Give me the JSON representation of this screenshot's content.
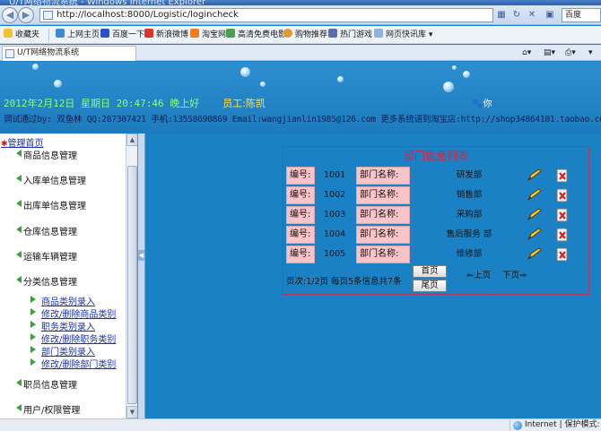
{
  "browser": {
    "window_title": "U/T网络物流系统 - Windows Internet Explorer",
    "url": "http://localhost:8000/Logistic/logincheck",
    "search_placeholder": "百度",
    "favorites_label": "收藏夹",
    "favorites": [
      "上网主页",
      "百度一下",
      "新浪微博",
      "淘宝网",
      "高清免费电影",
      "购物推荐",
      "热门游戏",
      "网页快讯库 ▾"
    ],
    "tab_title": "U/T网络物流系统",
    "status_zone": "Internet | 保护模式: 禁用"
  },
  "header": {
    "datetime": "2012年2月12日 星期日 20:47:46 晚上好",
    "staff": "员工:陈凯",
    "contact": "调试通过by: 双鱼林 QQ:287307421 手机:13558690869 Email:wangjianlin1985@126.com 更多系统请到淘宝店:http://shop34864101.taobao.com",
    "mascot_text": "你"
  },
  "menu": {
    "home": "管理首页",
    "categories": [
      "商品信息管理",
      "入库单信息管理",
      "出库单信息管理",
      "仓库信息管理",
      "运输车辆管理",
      "分类信息管理",
      "职员信息管理",
      "用户/权限管理"
    ],
    "subitems": [
      "商品类别录入",
      "修改/删除商品类别",
      "职务类别录入",
      "修改/删除职务类别",
      "部门类别录入",
      "修改/删除部门类别"
    ]
  },
  "main": {
    "title": "部门信息列表",
    "id_label": "编号:",
    "name_label": "部门名称:",
    "rows": [
      {
        "id": "1001",
        "name": "研发部"
      },
      {
        "id": "1002",
        "name": "销售部"
      },
      {
        "id": "1003",
        "name": "采购部"
      },
      {
        "id": "1004",
        "name": "售后服务 部"
      },
      {
        "id": "1005",
        "name": "维修部"
      }
    ],
    "pager_text": "页次:1/2页 每页5条信息共7条",
    "first_page": "首页",
    "last_page": "尾页",
    "prev_page": "⇐上页",
    "next_page": "下页⇒"
  }
}
